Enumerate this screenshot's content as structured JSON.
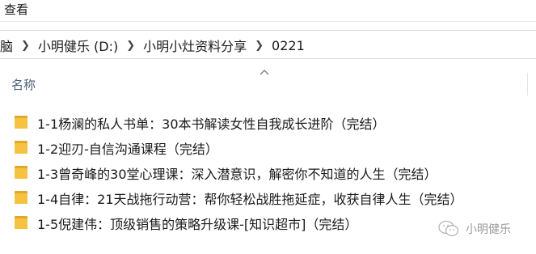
{
  "menubar": {
    "view_label": "查看"
  },
  "breadcrumb": {
    "items": [
      "脑",
      "小明健乐 (D:)",
      "小明小灶资料分享",
      "0221"
    ]
  },
  "columns": {
    "name_label": "名称"
  },
  "files": [
    {
      "name": "1-1杨澜的私人书单：30本书解读女性自我成长进阶（完结）"
    },
    {
      "name": "1-2迎刃-自信沟通课程（完结）"
    },
    {
      "name": "1-3曾奇峰的30堂心理课：深入潜意识，解密你不知道的人生（完结）"
    },
    {
      "name": "1-4自律：21天战拖行动营：帮你轻松战胜拖延症，收获自律人生（完结）"
    },
    {
      "name": "1-5倪建伟：顶级销售的策略升级课-[知识超市]（完结）"
    }
  ],
  "watermark": {
    "text": "小明健乐"
  },
  "colors": {
    "folder": "#f5c242",
    "folder_dark": "#e2a82a",
    "header_text": "#4c607a"
  },
  "icons": {
    "folder": "folder-icon",
    "separator": "chevron-right-icon",
    "sort": "sort-up-icon"
  }
}
